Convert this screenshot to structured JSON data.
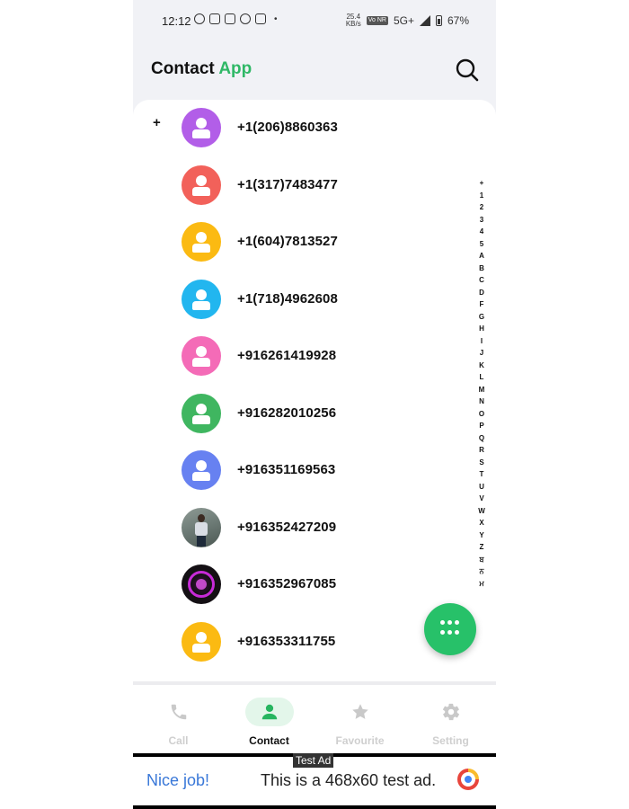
{
  "status_bar": {
    "time": "12:12",
    "net_speed_value": "25.4",
    "net_speed_unit": "KB/s",
    "volte": "Vo NR",
    "network": "5G+",
    "battery": "67%"
  },
  "header": {
    "title_main": "Contact",
    "title_accent": "App",
    "accent_color": "#2fb866"
  },
  "contacts": {
    "section_letter": "+",
    "items": [
      {
        "number": "+1(206)8860363",
        "avatar_color": "#b25ee8"
      },
      {
        "number": "+1(317)7483477",
        "avatar_color": "#f2615a"
      },
      {
        "number": "+1(604)7813527",
        "avatar_color": "#fbba12"
      },
      {
        "number": "+1(718)4962608",
        "avatar_color": "#22b6ef"
      },
      {
        "number": "+916261419928",
        "avatar_color": "#f46bb7"
      },
      {
        "number": "+916282010256",
        "avatar_color": "#3fb660"
      },
      {
        "number": "+916351169563",
        "avatar_color": "#6781f1"
      },
      {
        "number": "+916352427209",
        "avatar_color": "photo"
      },
      {
        "number": "+916352967085",
        "avatar_color": "photo"
      },
      {
        "number": "+916353311755",
        "avatar_color": "#fbba12"
      }
    ]
  },
  "alphabet_index": [
    "+",
    "1",
    "2",
    "3",
    "4",
    "5",
    "A",
    "B",
    "C",
    "D",
    "F",
    "G",
    "H",
    "I",
    "J",
    "K",
    "L",
    "M",
    "N",
    "O",
    "P",
    "Q",
    "R",
    "S",
    "T",
    "U",
    "V",
    "W",
    "X",
    "Y",
    "Z",
    "ਬ",
    "ਨ",
    "ਮ"
  ],
  "bottom_nav": {
    "items": [
      {
        "label": "Call",
        "icon": "phone-icon",
        "active": false
      },
      {
        "label": "Contact",
        "icon": "person-icon",
        "active": true
      },
      {
        "label": "Favourite",
        "icon": "star-icon",
        "active": false
      },
      {
        "label": "Setting",
        "icon": "gear-icon",
        "active": false
      }
    ]
  },
  "ad": {
    "tag": "Test Ad",
    "headline": "Nice job!",
    "text": "This is a 468x60 test ad."
  }
}
